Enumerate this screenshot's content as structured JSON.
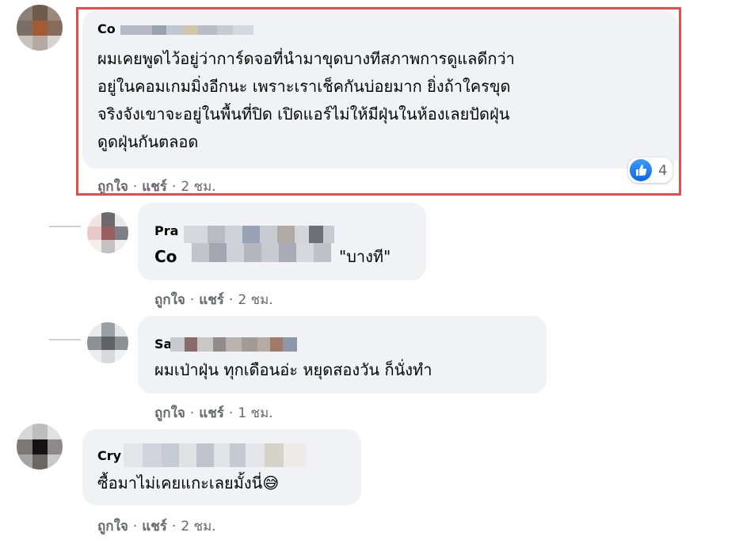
{
  "comments": [
    {
      "name": "Co",
      "text_lines": [
        "ผมเคยพูดไว้อยู่ว่าการ์ดจอที่นำมาขุดบางทีสภาพการดูแลดีกว่า",
        "อยู่ในคอมเกมมิ่งอีกนะ เพราะเราเช็คกันบ่อยมาก ยิ่งถ้าใครขุด",
        "จริงจังเขาจะอยู่ในพื้นที่ปิด เปิดแอร์ไม่ให้มีฝุ่นในห้องเลยปัดฝุ่น",
        "ดูดฝุ่นกันตลอด"
      ],
      "like_label": "ถูกใจ",
      "share_label": "แชร์",
      "time": "2 ชม.",
      "reaction_count": "4",
      "reaction_icon": "like-icon"
    },
    {
      "name": "Pra",
      "mention": "Co",
      "text": "\"บางที\"",
      "like_label": "ถูกใจ",
      "share_label": "แชร์",
      "time": "2 ชม."
    },
    {
      "name": "Sa",
      "text": "ผมเป่าฝุ่น ทุกเดือนอ่ะ หยุดสองวัน ก็นั่งทำ",
      "like_label": "ถูกใจ",
      "share_label": "แชร์",
      "time": "1 ชม."
    },
    {
      "name": "Cry",
      "text": "ซื้อมาไม่เคยแกะเลยมั้งนี่",
      "emoji": "😅",
      "like_label": "ถูกใจ",
      "share_label": "แชร์",
      "time": "2 ชม."
    }
  ],
  "colors": {
    "bubble": "#f0f2f5",
    "meta_text": "#65676b",
    "highlight_border": "#e74c4c",
    "like_blue": "#1877f2"
  }
}
